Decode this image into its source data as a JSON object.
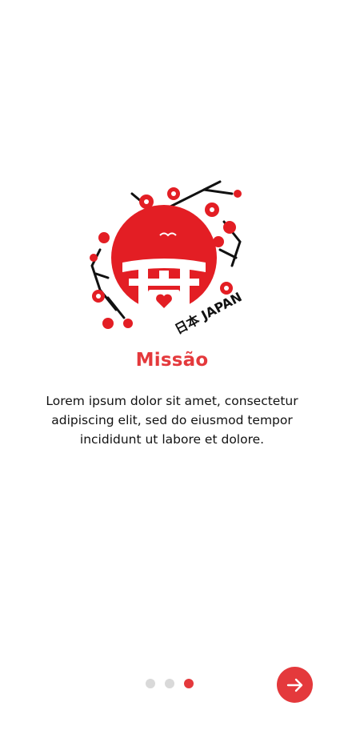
{
  "slide": {
    "title": "Missão",
    "description": "Lorem ipsum dolor sit amet, consectetur adipiscing elit, sed do eiusmod tempor incididunt ut labore et dolore.",
    "illustration_text": "日本 JAPAN",
    "illustration_icon": "japan-torii-sun-illustration"
  },
  "pagination": {
    "total": 3,
    "active_index": 2,
    "active_color": "#e4393c",
    "inactive_color": "#d9d9d9"
  },
  "next_button": {
    "icon": "arrow-right-icon",
    "color": "#e4393c"
  }
}
